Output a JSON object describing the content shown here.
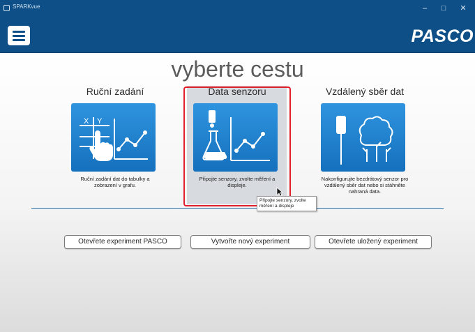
{
  "window": {
    "title": "SPARKvue",
    "minimize": "–",
    "maximize": "□",
    "close": "✕"
  },
  "toolbar": {
    "brand": "PASCO"
  },
  "main": {
    "heading": "vyberte cestu",
    "paths": [
      {
        "label": "Ruční zadání",
        "description": "Ruční zadání dat do tabulky a zobrazení v grafu.",
        "icon": "manual-entry-icon"
      },
      {
        "label": "Data senzoru",
        "description": "Připojte senzory, zvolte měření a displeje.",
        "icon": "sensor-data-icon",
        "selected": true
      },
      {
        "label": "Vzdálený sběr dat",
        "description": "Nakonfigurujte bezdrátový senzor pro vzdálený sběr dat nebo si stáhněte nahraná data.",
        "icon": "remote-logging-icon"
      }
    ],
    "tooltip": "Připojte senzory, zvolte měření a displeje",
    "actions": {
      "open_pasco": "Otevřete experiment PASCO",
      "new_experiment": "Vytvořte nový experiment",
      "open_saved": "Otevřete uložený experiment"
    }
  },
  "colors": {
    "titlebar": "#0d4f86",
    "tile": "#1f83d0",
    "highlight": "#e0202c",
    "separator": "#2a6fa6"
  }
}
